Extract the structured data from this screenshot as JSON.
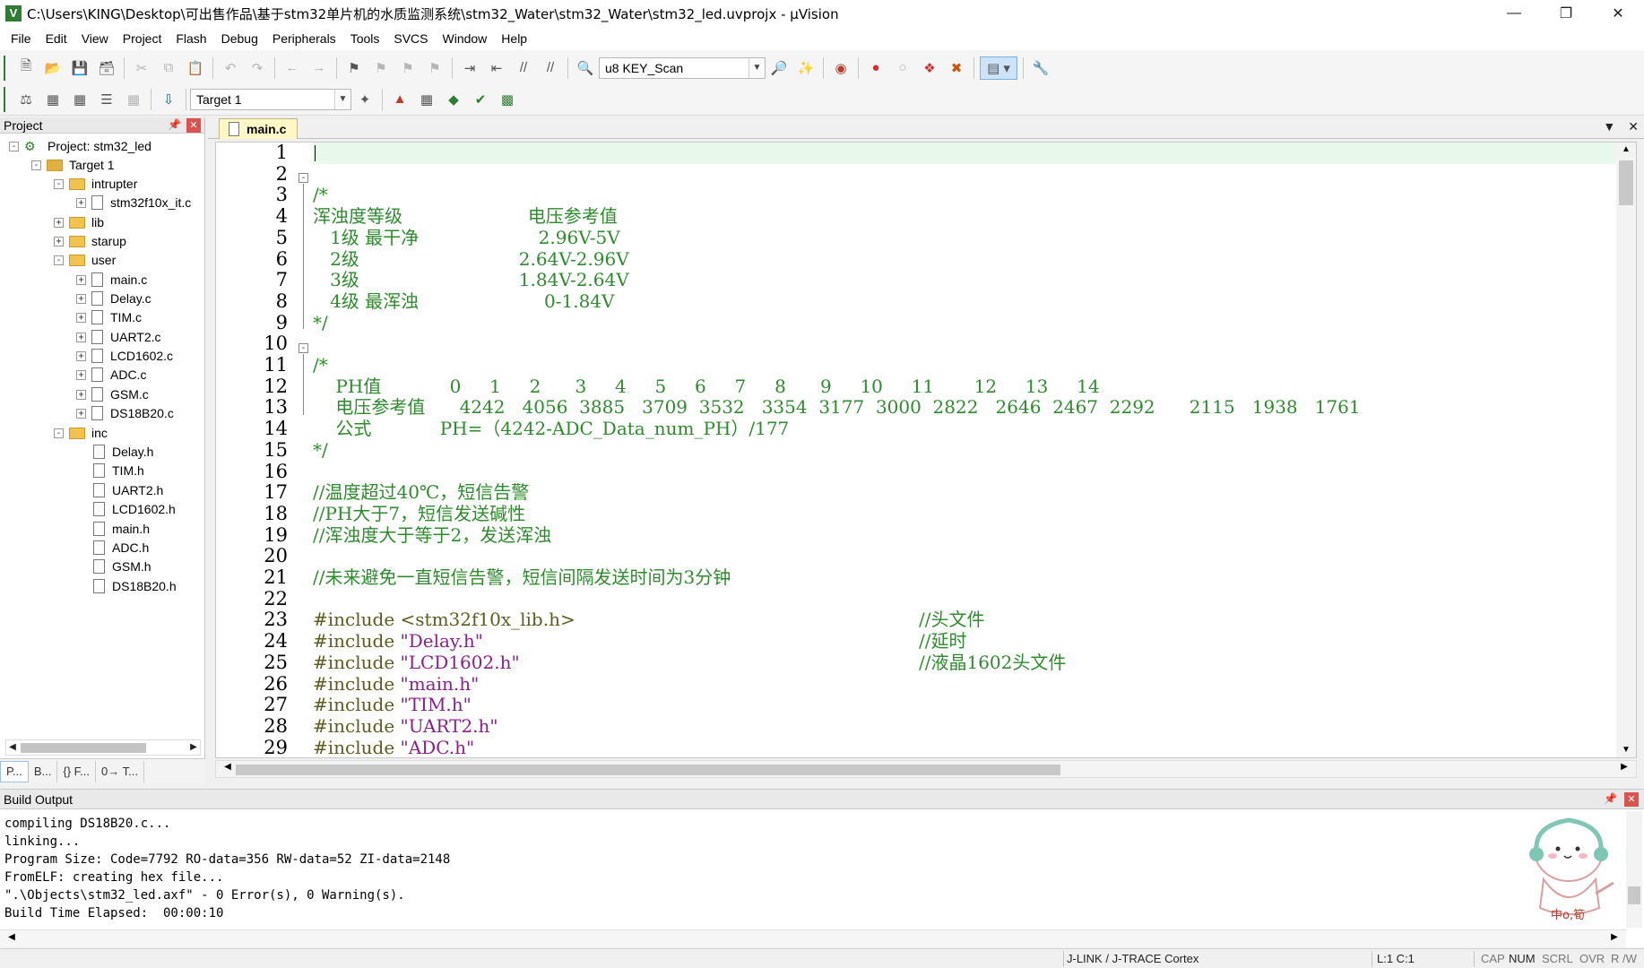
{
  "window": {
    "title": "C:\\Users\\KING\\Desktop\\可出售作品\\基于stm32单片机的水质监测系统\\stm32_Water\\stm32_Water\\stm32_led.uvprojx - µVision"
  },
  "menu": [
    "File",
    "Edit",
    "View",
    "Project",
    "Flash",
    "Debug",
    "Peripherals",
    "Tools",
    "SVCS",
    "Window",
    "Help"
  ],
  "toolbar": {
    "find_combo_value": "u8 KEY_Scan",
    "target_combo_value": "Target 1"
  },
  "project_panel": {
    "title": "Project",
    "tree": [
      {
        "label": "Project: stm32_led",
        "kind": "project"
      },
      {
        "label": "Target 1",
        "kind": "target"
      },
      {
        "label": "intrupter",
        "kind": "folder"
      },
      {
        "label": "stm32f10x_it.c",
        "kind": "file"
      },
      {
        "label": "lib",
        "kind": "folder"
      },
      {
        "label": "starup",
        "kind": "folder"
      },
      {
        "label": "user",
        "kind": "folder"
      },
      {
        "label": "main.c",
        "kind": "file"
      },
      {
        "label": "Delay.c",
        "kind": "file"
      },
      {
        "label": "TIM.c",
        "kind": "file"
      },
      {
        "label": "UART2.c",
        "kind": "file"
      },
      {
        "label": "LCD1602.c",
        "kind": "file"
      },
      {
        "label": "ADC.c",
        "kind": "file"
      },
      {
        "label": "GSM.c",
        "kind": "file"
      },
      {
        "label": "DS18B20.c",
        "kind": "file"
      },
      {
        "label": "inc",
        "kind": "folder"
      },
      {
        "label": "Delay.h",
        "kind": "file"
      },
      {
        "label": "TIM.h",
        "kind": "file"
      },
      {
        "label": "UART2.h",
        "kind": "file"
      },
      {
        "label": "LCD1602.h",
        "kind": "file"
      },
      {
        "label": "main.h",
        "kind": "file"
      },
      {
        "label": "ADC.h",
        "kind": "file"
      },
      {
        "label": "GSM.h",
        "kind": "file"
      },
      {
        "label": "DS18B20.h",
        "kind": "file"
      }
    ],
    "bottom_tabs": [
      "P...",
      "B...",
      "{} F...",
      "0→ T..."
    ]
  },
  "editor": {
    "active_tab": "main.c",
    "line_numbers": [
      "1",
      "2",
      "3",
      "4",
      "5",
      "6",
      "7",
      "8",
      "9",
      "10",
      "11",
      "12",
      "13",
      "14",
      "15",
      "16",
      "17",
      "18",
      "19",
      "20",
      "21",
      "22",
      "23",
      "24",
      "25",
      "26",
      "27",
      "28",
      "29"
    ],
    "lines": [
      "",
      "",
      "/*",
      "浑浊度等级                      电压参考值",
      "   1级 最干净                     2.96V-5V",
      "   2级                            2.64V-2.96V",
      "   3级                            1.84V-2.64V",
      "   4级 最浑浊                      0-1.84V",
      "*/",
      "",
      "/*",
      "    PH值            0     1     2      3     4     5     6     7     8      9     10     11       12     13     14",
      "    电压参考值      4242   4056  3885   3709  3532   3354  3177  3000  2822   2646  2467  2292      2115   1938   1761",
      "    公式            PH=（4242-ADC_Data_num_PH）/177",
      "*/",
      "",
      "//温度超过40℃，短信告警",
      "//PH大于7，短信发送碱性",
      "//浑浊度大于等于2，发送浑浊",
      "",
      "//未来避免一直短信告警，短信间隔发送时间为3分钟",
      "",
      "#include <stm32f10x_lib.h>",
      "#include \"Delay.h\"",
      "#include \"LCD1602.h\"",
      "#include \"main.h\"",
      "#include \"TIM.h\"",
      "#include \"UART2.h\"",
      "#include \"ADC.h\""
    ],
    "trailing_comments": {
      "line23": "//头文件",
      "line24": "//延时",
      "line25": "//液晶1602头文件"
    }
  },
  "build_output": {
    "title": "Build Output",
    "lines": [
      "compiling DS18B20.c...",
      "linking...",
      "Program Size: Code=7792 RO-data=356 RW-data=52 ZI-data=2148",
      "FromELF: creating hex file...",
      "\".\\Objects\\stm32_led.axf\" - 0 Error(s), 0 Warning(s).",
      "Build Time Elapsed:  00:00:10"
    ]
  },
  "statusbar": {
    "debugger": "J-LINK / J-TRACE Cortex",
    "position": "L:1 C:1",
    "cap": "CAP",
    "num": "NUM",
    "scrl": "SCRL",
    "ovr": "OVR",
    "rw": "R /W"
  },
  "colors": {
    "comment": "#2e8b2e",
    "preprocessor": "#5d5d1f",
    "string": "#8b1f8b",
    "current_line": "#e8f9ec",
    "tab_active": "#fff8c4"
  }
}
